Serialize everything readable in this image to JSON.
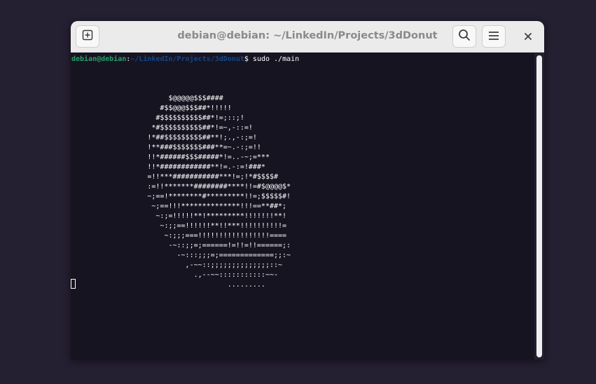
{
  "window": {
    "title": "debian@debian: ~/LinkedIn/Projects/3dDonut"
  },
  "titlebar": {
    "new_tab_icon": "new-tab-icon",
    "search_icon": "search-icon",
    "menu_icon": "hamburger-menu-icon",
    "close_icon": "close-icon"
  },
  "terminal": {
    "prompt_user": "debian@debian",
    "prompt_sep": ":",
    "prompt_path": "~/LinkedIn/Projects/3dDonut",
    "prompt_dollar": "$ ",
    "command": "sudo ./main",
    "output": "                       $@@@@@$$$####\n                     #$$@@@$$$##*!!!!!\n                    #$$$$$$$$$$##*!=;::;!\n                   *#$$$$$$$$$$##*!=~,-::=!\n                  !*##$$$$$$$$$##**!;.,-:;=!\n                  !**###$$$$$$$###**=~.-:;=!!\n                  !!*######$$$#####*!=..-~;=***\n                  !!*############**!=.-:=!###*\n                  =!!***###########***!=;!*#$$$$#\n                  :=!!*******########****!!=#$@@@@$*\n                  ~;==!********#*********!!=;$$$$$#!\n                   ~;==!!!**************!!!==**##*;\n                    ~:;=!!!!!**!*********!!!!!!!**!\n                     ~:;;==!!!!!!**!!***!!!!!!!!!!=\n                      ~:;;;===!!!!!!!!!!!!!!!!!====\n                       -~::;;=;======!=!!=!!======;:\n                         -~:::;;;=;=============;;:~\n                           ,-~~::;;;;;;;;;;;;;;::~\n                             .,--~~:::::::::::~~-\n                                     ........."
  }
}
